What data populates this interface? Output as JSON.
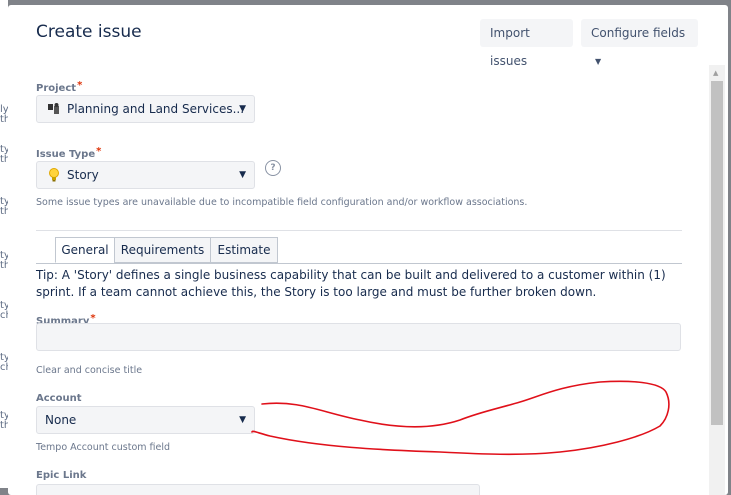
{
  "background_fragments": [
    "ly",
    "th",
    "ty",
    "th",
    "ty",
    "th",
    "ty",
    "th",
    "ty",
    "ch",
    "ty",
    "ch",
    "ty",
    "th"
  ],
  "dialog": {
    "title": "Create issue",
    "import_button": "Import issues",
    "configure_button": "Configure fields"
  },
  "form": {
    "project": {
      "label": "Project",
      "required": "*",
      "value": "Planning and Land Services..."
    },
    "issue_type": {
      "label": "Issue Type",
      "required": "*",
      "value": "Story",
      "help": "?",
      "note": "Some issue types are unavailable due to incompatible field configuration and/or workflow associations."
    },
    "tabs": [
      "General",
      "Requirements",
      "Estimate"
    ],
    "tip": "Tip: A 'Story' defines a single business capability that can be built and delivered to a customer within (1) sprint. If a team cannot achieve this, the Story is too large and must be further broken down.",
    "summary": {
      "label": "Summary",
      "required": "*",
      "value": "",
      "hint": "Clear and concise title"
    },
    "account": {
      "label": "Account",
      "value": "None",
      "hint": "Tempo Account custom field"
    },
    "epic_link": {
      "label": "Epic Link"
    }
  },
  "colors": {
    "annotation": "#e0101a",
    "required": "#de350b"
  }
}
